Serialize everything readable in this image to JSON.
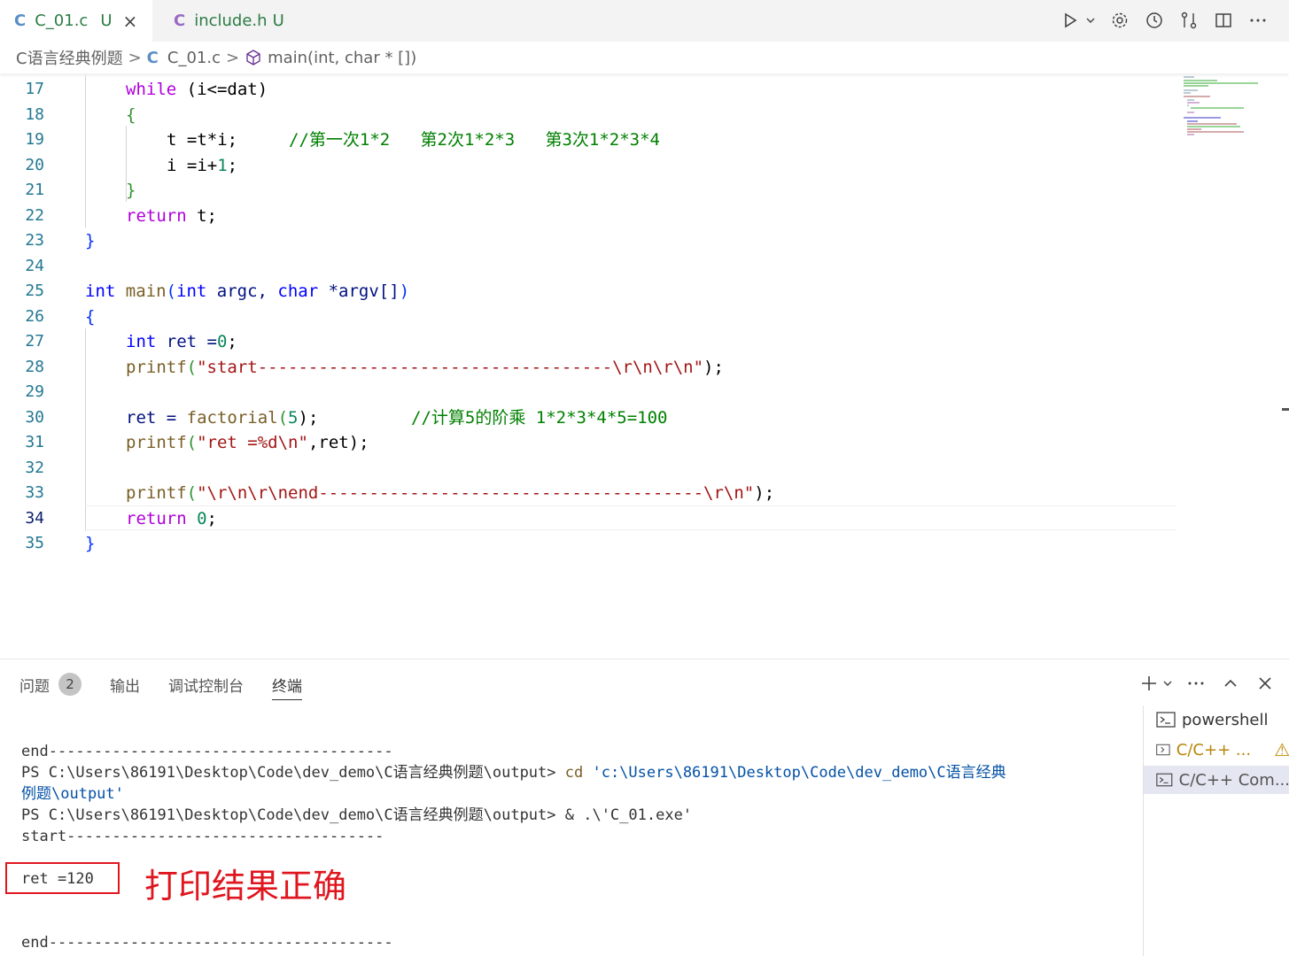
{
  "tabs": [
    {
      "lang": "C",
      "name": "C_01.c",
      "status": "U",
      "close": "×",
      "active": true
    },
    {
      "lang": "C",
      "name": "include.h",
      "status": "U",
      "active": false
    }
  ],
  "toolbar_icons": [
    "run-icon",
    "chevron-down-icon",
    "gear-icon",
    "history-icon",
    "compare-icon",
    "split-editor-icon",
    "more-icon"
  ],
  "breadcrumb": {
    "folder": "C语言经典例题",
    "file_lang": "C",
    "file": "C_01.c",
    "symbol": "main(int, char * [])",
    "separator": ">"
  },
  "editor": {
    "current_line": "34",
    "lines": [
      {
        "n": "17"
      },
      {
        "n": "18"
      },
      {
        "n": "19"
      },
      {
        "n": "20"
      },
      {
        "n": "21"
      },
      {
        "n": "22"
      },
      {
        "n": "23"
      },
      {
        "n": "24"
      },
      {
        "n": "25"
      },
      {
        "n": "26"
      },
      {
        "n": "27"
      },
      {
        "n": "28"
      },
      {
        "n": "29"
      },
      {
        "n": "30"
      },
      {
        "n": "31"
      },
      {
        "n": "32"
      },
      {
        "n": "33"
      },
      {
        "n": "34"
      },
      {
        "n": "35"
      }
    ],
    "code": {
      "l17": {
        "kw": "while",
        "rest": " (i<=dat)"
      },
      "l18": "{",
      "l19": {
        "code": "t =t*i;",
        "comment": "//第一次1*2   第2次1*2*3   第3次1*2*3*4"
      },
      "l20": {
        "a": "i =i+",
        "num": "1",
        "b": ";"
      },
      "l21": "}",
      "l22": {
        "kw": "return",
        "rest": " t;"
      },
      "l23": "}",
      "l25": {
        "t1": "int",
        "fn": "main",
        "t2": "int",
        "p1": " argc, ",
        "t3": "char",
        "p2": " *argv[]"
      },
      "l26": "{",
      "l27": {
        "t": "int",
        "rest": " ret =",
        "num": "0",
        "end": ";"
      },
      "l28": {
        "fn": "printf",
        "str": "\"start-----------------------------------\\r\\n\\r\\n\"",
        "end": ");"
      },
      "l30": {
        "a": "ret = ",
        "fn": "factorial",
        "num": "5",
        "end": ");",
        "comment": "//计算5的阶乘 1*2*3*4*5=100"
      },
      "l31": {
        "fn": "printf",
        "str": "\"ret =%d\\n\"",
        "end": ",ret);"
      },
      "l33": {
        "fn": "printf",
        "str": "\"\\r\\n\\r\\nend--------------------------------------\\r\\n\"",
        "end": ");"
      },
      "l34": {
        "kw": "return",
        "num": "0",
        "end": ";"
      },
      "l35": "}"
    }
  },
  "panel": {
    "tabs": [
      {
        "label": "问题",
        "badge": "2"
      },
      {
        "label": "输出"
      },
      {
        "label": "调试控制台"
      },
      {
        "label": "终端",
        "active": true
      }
    ],
    "terminal": {
      "line1": "end--------------------------------------",
      "line2_prompt": "PS C:\\Users\\86191\\Desktop\\Code\\dev_demo\\C语言经典例题\\output> ",
      "line2_cmd": "cd",
      "line2_arg": " 'c:\\Users\\86191\\Desktop\\Code\\dev_demo\\C语言经典",
      "line3_arg": "例题\\output'",
      "line4_prompt": "PS C:\\Users\\86191\\Desktop\\Code\\dev_demo\\C语言经典例题\\output> ",
      "line4_cmd": "& .\\'C_01.exe'",
      "line5": "start-----------------------------------",
      "line6": "ret =120",
      "line7": "end--------------------------------------"
    },
    "terminal_list": [
      {
        "label": "powershell"
      },
      {
        "label": "C/C++ ...",
        "warn": "⚠"
      },
      {
        "label": "C/C++ Com...",
        "selected": true
      }
    ]
  },
  "annotation": {
    "text": "打印结果正确",
    "color": "#e0161f"
  },
  "colors": {
    "accent": "#0078d4",
    "comment": "#008000",
    "keyword": "#0000ff",
    "control": "#af00db",
    "string": "#a31515",
    "line_number": "#237893"
  }
}
